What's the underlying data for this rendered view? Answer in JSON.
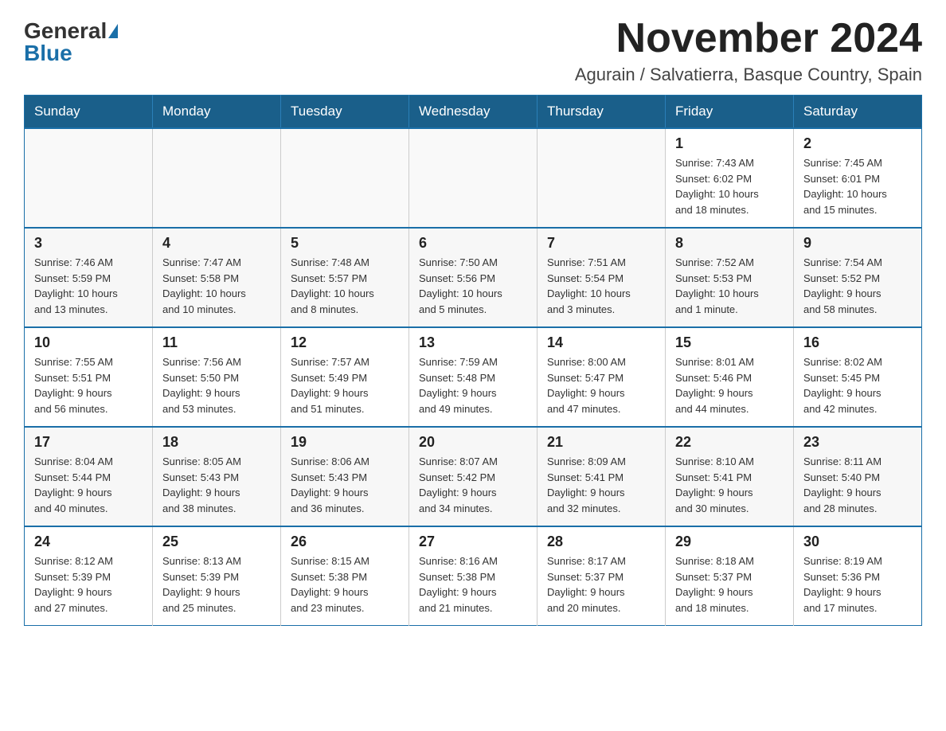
{
  "logo": {
    "general_text": "General",
    "blue_text": "Blue"
  },
  "title": "November 2024",
  "subtitle": "Agurain / Salvatierra, Basque Country, Spain",
  "days_of_week": [
    "Sunday",
    "Monday",
    "Tuesday",
    "Wednesday",
    "Thursday",
    "Friday",
    "Saturday"
  ],
  "weeks": [
    {
      "days": [
        {
          "num": "",
          "info": ""
        },
        {
          "num": "",
          "info": ""
        },
        {
          "num": "",
          "info": ""
        },
        {
          "num": "",
          "info": ""
        },
        {
          "num": "",
          "info": ""
        },
        {
          "num": "1",
          "info": "Sunrise: 7:43 AM\nSunset: 6:02 PM\nDaylight: 10 hours\nand 18 minutes."
        },
        {
          "num": "2",
          "info": "Sunrise: 7:45 AM\nSunset: 6:01 PM\nDaylight: 10 hours\nand 15 minutes."
        }
      ]
    },
    {
      "days": [
        {
          "num": "3",
          "info": "Sunrise: 7:46 AM\nSunset: 5:59 PM\nDaylight: 10 hours\nand 13 minutes."
        },
        {
          "num": "4",
          "info": "Sunrise: 7:47 AM\nSunset: 5:58 PM\nDaylight: 10 hours\nand 10 minutes."
        },
        {
          "num": "5",
          "info": "Sunrise: 7:48 AM\nSunset: 5:57 PM\nDaylight: 10 hours\nand 8 minutes."
        },
        {
          "num": "6",
          "info": "Sunrise: 7:50 AM\nSunset: 5:56 PM\nDaylight: 10 hours\nand 5 minutes."
        },
        {
          "num": "7",
          "info": "Sunrise: 7:51 AM\nSunset: 5:54 PM\nDaylight: 10 hours\nand 3 minutes."
        },
        {
          "num": "8",
          "info": "Sunrise: 7:52 AM\nSunset: 5:53 PM\nDaylight: 10 hours\nand 1 minute."
        },
        {
          "num": "9",
          "info": "Sunrise: 7:54 AM\nSunset: 5:52 PM\nDaylight: 9 hours\nand 58 minutes."
        }
      ]
    },
    {
      "days": [
        {
          "num": "10",
          "info": "Sunrise: 7:55 AM\nSunset: 5:51 PM\nDaylight: 9 hours\nand 56 minutes."
        },
        {
          "num": "11",
          "info": "Sunrise: 7:56 AM\nSunset: 5:50 PM\nDaylight: 9 hours\nand 53 minutes."
        },
        {
          "num": "12",
          "info": "Sunrise: 7:57 AM\nSunset: 5:49 PM\nDaylight: 9 hours\nand 51 minutes."
        },
        {
          "num": "13",
          "info": "Sunrise: 7:59 AM\nSunset: 5:48 PM\nDaylight: 9 hours\nand 49 minutes."
        },
        {
          "num": "14",
          "info": "Sunrise: 8:00 AM\nSunset: 5:47 PM\nDaylight: 9 hours\nand 47 minutes."
        },
        {
          "num": "15",
          "info": "Sunrise: 8:01 AM\nSunset: 5:46 PM\nDaylight: 9 hours\nand 44 minutes."
        },
        {
          "num": "16",
          "info": "Sunrise: 8:02 AM\nSunset: 5:45 PM\nDaylight: 9 hours\nand 42 minutes."
        }
      ]
    },
    {
      "days": [
        {
          "num": "17",
          "info": "Sunrise: 8:04 AM\nSunset: 5:44 PM\nDaylight: 9 hours\nand 40 minutes."
        },
        {
          "num": "18",
          "info": "Sunrise: 8:05 AM\nSunset: 5:43 PM\nDaylight: 9 hours\nand 38 minutes."
        },
        {
          "num": "19",
          "info": "Sunrise: 8:06 AM\nSunset: 5:43 PM\nDaylight: 9 hours\nand 36 minutes."
        },
        {
          "num": "20",
          "info": "Sunrise: 8:07 AM\nSunset: 5:42 PM\nDaylight: 9 hours\nand 34 minutes."
        },
        {
          "num": "21",
          "info": "Sunrise: 8:09 AM\nSunset: 5:41 PM\nDaylight: 9 hours\nand 32 minutes."
        },
        {
          "num": "22",
          "info": "Sunrise: 8:10 AM\nSunset: 5:41 PM\nDaylight: 9 hours\nand 30 minutes."
        },
        {
          "num": "23",
          "info": "Sunrise: 8:11 AM\nSunset: 5:40 PM\nDaylight: 9 hours\nand 28 minutes."
        }
      ]
    },
    {
      "days": [
        {
          "num": "24",
          "info": "Sunrise: 8:12 AM\nSunset: 5:39 PM\nDaylight: 9 hours\nand 27 minutes."
        },
        {
          "num": "25",
          "info": "Sunrise: 8:13 AM\nSunset: 5:39 PM\nDaylight: 9 hours\nand 25 minutes."
        },
        {
          "num": "26",
          "info": "Sunrise: 8:15 AM\nSunset: 5:38 PM\nDaylight: 9 hours\nand 23 minutes."
        },
        {
          "num": "27",
          "info": "Sunrise: 8:16 AM\nSunset: 5:38 PM\nDaylight: 9 hours\nand 21 minutes."
        },
        {
          "num": "28",
          "info": "Sunrise: 8:17 AM\nSunset: 5:37 PM\nDaylight: 9 hours\nand 20 minutes."
        },
        {
          "num": "29",
          "info": "Sunrise: 8:18 AM\nSunset: 5:37 PM\nDaylight: 9 hours\nand 18 minutes."
        },
        {
          "num": "30",
          "info": "Sunrise: 8:19 AM\nSunset: 5:36 PM\nDaylight: 9 hours\nand 17 minutes."
        }
      ]
    }
  ]
}
